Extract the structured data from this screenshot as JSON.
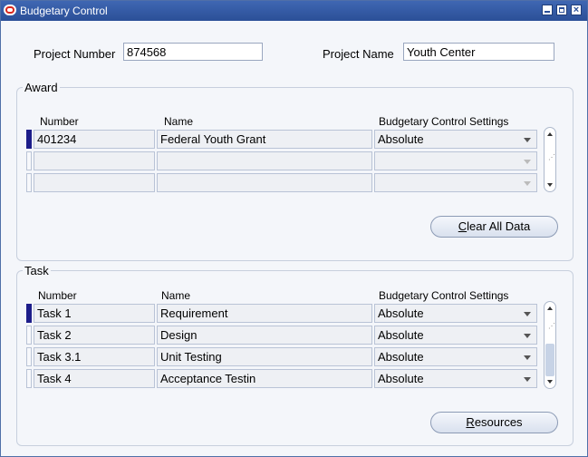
{
  "window": {
    "title": "Budgetary Control"
  },
  "header": {
    "project_number_label": "Project Number",
    "project_number": "874568",
    "project_name_label": "Project Name",
    "project_name": "Youth Center"
  },
  "award": {
    "group_title": "Award",
    "columns": [
      "Number",
      "Name",
      "Budgetary Control Settings"
    ],
    "rows": [
      {
        "number": "401234",
        "name": "Federal Youth Grant",
        "setting": "Absolute"
      },
      {
        "number": "",
        "name": "",
        "setting": ""
      },
      {
        "number": "",
        "name": "",
        "setting": ""
      }
    ],
    "button_mnemonic": "C",
    "button_rest": "lear All Data"
  },
  "task": {
    "group_title": "Task",
    "columns": [
      "Number",
      "Name",
      "Budgetary Control Settings"
    ],
    "rows": [
      {
        "number": "Task 1",
        "name": "Requirement",
        "setting": "Absolute"
      },
      {
        "number": "Task 2",
        "name": "Design",
        "setting": "Absolute"
      },
      {
        "number": "Task 3.1",
        "name": "Unit Testing",
        "setting": "Absolute"
      },
      {
        "number": "Task 4",
        "name": "Acceptance Testin",
        "setting": "Absolute"
      }
    ],
    "button_mnemonic": "R",
    "button_rest": "esources"
  },
  "icons": [
    "oracle-logo-icon",
    "minimize-icon",
    "maximize-icon",
    "close-icon",
    "scroll-up-icon",
    "scroll-down-icon",
    "dropdown-arrow-icon"
  ]
}
